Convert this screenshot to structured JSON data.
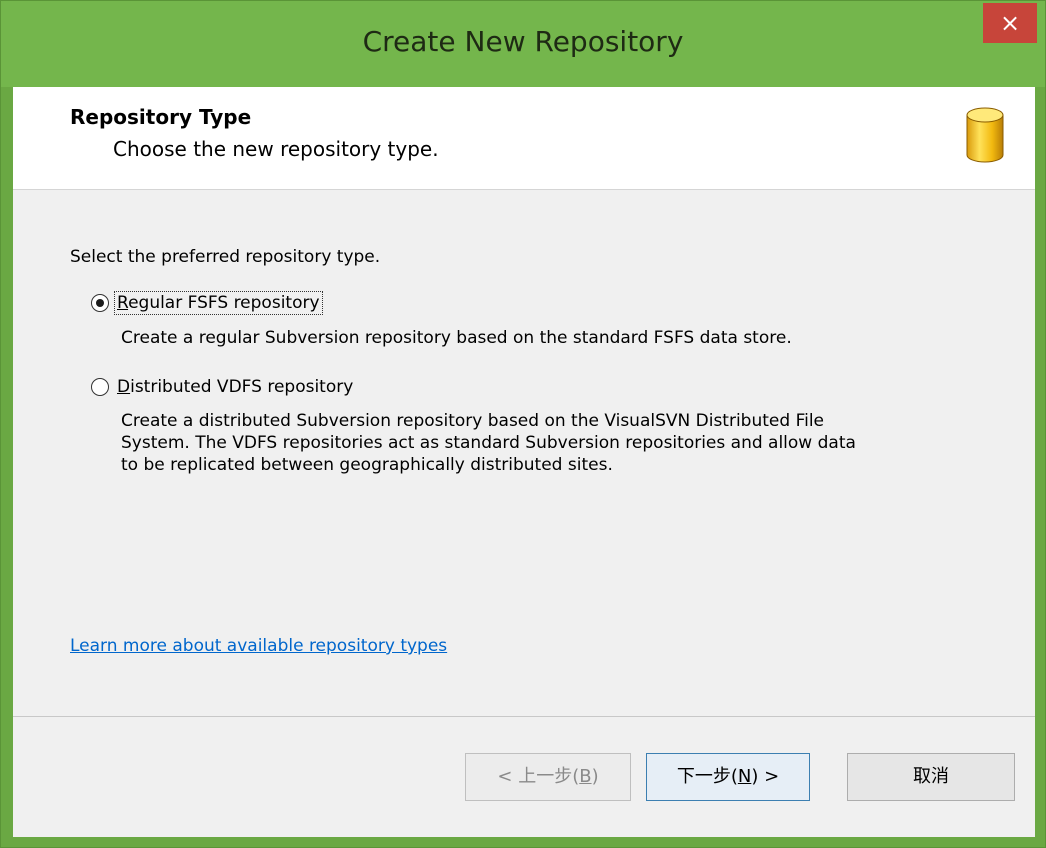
{
  "window": {
    "title": "Create New Repository",
    "close_glyph": "×"
  },
  "header": {
    "title": "Repository Type",
    "subtitle": "Choose the new repository type.",
    "icon": "database-icon"
  },
  "main": {
    "prompt": "Select the preferred repository type.",
    "options": [
      {
        "label_mnemonic": "R",
        "label_rest": "egular FSFS repository",
        "selected": true,
        "description": "Create a regular Subversion repository based on the standard FSFS data store."
      },
      {
        "label_mnemonic": "D",
        "label_rest": "istributed VDFS repository",
        "selected": false,
        "description_lines": [
          "Create a distributed Subversion repository based on the VisualSVN Distributed File",
          "System. The VDFS repositories act as standard Subversion repositories and allow data",
          "to be replicated between geographically distributed sites."
        ]
      }
    ],
    "learn_more_link": "Learn more about available repository types"
  },
  "footer": {
    "back_prefix": "< 上一步(",
    "back_mnemonic": "B",
    "back_suffix": ")",
    "next_prefix": "下一步(",
    "next_mnemonic": "N",
    "next_suffix": ") >",
    "cancel_label": "取消"
  },
  "colors": {
    "titlebar": "#74b64c",
    "close_button": "#c7453a",
    "link": "#0066cc"
  }
}
